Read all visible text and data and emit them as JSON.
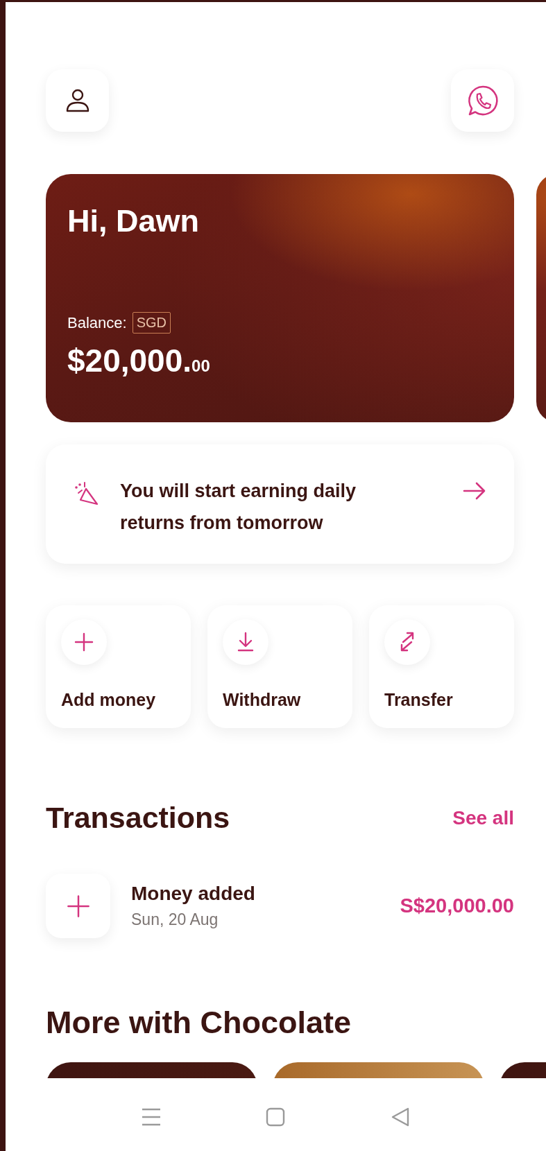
{
  "balance_card": {
    "greeting": "Hi, Dawn",
    "balance_label": "Balance:",
    "currency": "SGD",
    "amount": "$20,000.",
    "amount_cents": "00"
  },
  "notice": {
    "text": "You will start earning daily returns from tomorrow"
  },
  "actions": [
    {
      "kind": "add",
      "label": "Add money"
    },
    {
      "kind": "withdraw",
      "label": "Withdraw"
    },
    {
      "kind": "transfer",
      "label": "Transfer"
    }
  ],
  "transactions": {
    "title": "Transactions",
    "see_all": "See all",
    "items": [
      {
        "kind": "added",
        "title": "Money added",
        "date": "Sun, 20 Aug",
        "amount": "S$20,000.00"
      }
    ]
  },
  "more": {
    "title": "More with Chocolate",
    "cards": [
      {
        "kind": "dark"
      },
      {
        "kind": "gold"
      },
      {
        "kind": "dark"
      }
    ]
  }
}
